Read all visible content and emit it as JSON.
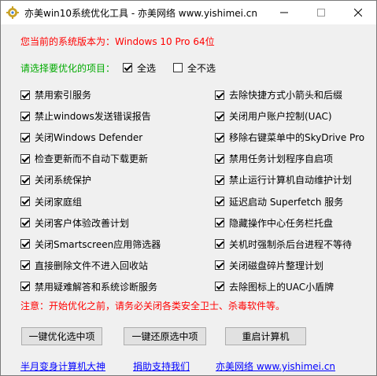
{
  "window": {
    "title": "亦美win10系统优化工具 - 亦美网络 www.yishimei.cn",
    "colors": {
      "titlebar": "#ffffff",
      "body": "#f0f0f0",
      "accent_red": "#ff0000",
      "accent_green": "#00aa00",
      "link": "#0000ff"
    }
  },
  "system_info": "您当前的系统版本为：Windows 10 Pro  64位",
  "select_section": {
    "label": "请选择要优化的项目：",
    "select_all": {
      "label": "全选",
      "checked": true
    },
    "select_none": {
      "label": "全不选",
      "checked": false
    }
  },
  "options_left": [
    {
      "label": "禁用索引服务",
      "checked": true
    },
    {
      "label": "禁止windows发送错误报告",
      "checked": true
    },
    {
      "label": "关闭Windows Defender",
      "checked": true
    },
    {
      "label": "检查更新而不自动下载更新",
      "checked": true
    },
    {
      "label": "关闭系统保护",
      "checked": true
    },
    {
      "label": "关闭家庭组",
      "checked": true
    },
    {
      "label": "关闭客户体验改善计划",
      "checked": true
    },
    {
      "label": "关闭Smartscreen应用筛选器",
      "checked": true
    },
    {
      "label": "直接删除文件不进入回收站",
      "checked": true
    },
    {
      "label": "禁用疑难解答和系统诊断服务",
      "checked": true
    }
  ],
  "options_right": [
    {
      "label": "去除快捷方式小箭头和后缀",
      "checked": true
    },
    {
      "label": "关闭用户账户控制(UAC)",
      "checked": true
    },
    {
      "label": "移除右键菜单中的SkyDrive Pro",
      "checked": true
    },
    {
      "label": "禁用任务计划程序自启项",
      "checked": true
    },
    {
      "label": "禁止运行计算机自动维护计划",
      "checked": true
    },
    {
      "label": "延迟启动 Superfetch 服务",
      "checked": true
    },
    {
      "label": "隐藏操作中心任务栏托盘",
      "checked": true
    },
    {
      "label": "关机时强制杀后台进程不等待",
      "checked": true
    },
    {
      "label": "关闭磁盘碎片整理计划",
      "checked": true
    },
    {
      "label": "去除图标上的UAC小盾牌",
      "checked": true
    }
  ],
  "notice": "注意：开始优化之前，请务必关闭各类安全卫士、杀毒软件等。",
  "buttons": {
    "optimize": "一键优化选中项",
    "restore": "一键还原选中项",
    "reboot": "重启计算机"
  },
  "links": {
    "author": "半月变身计算机大神",
    "donate": "捐助支持我们",
    "site": "亦美网络 www.yishimei.cn"
  }
}
